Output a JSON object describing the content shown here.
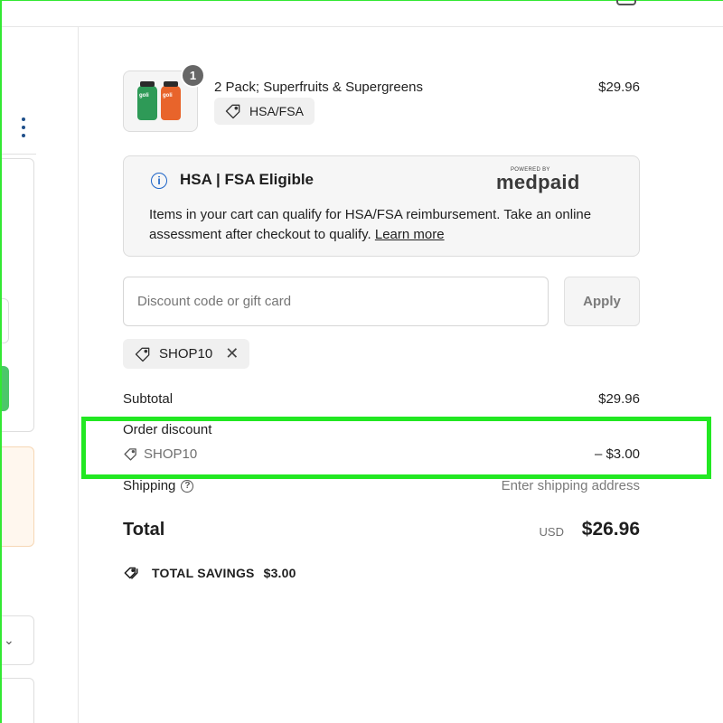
{
  "product": {
    "quantity": "1",
    "title": "2 Pack; Superfruits & Supergreens",
    "price": "$29.96",
    "tag": "HSA/FSA",
    "bottle_label_1": "goli",
    "bottle_label_2": "goli"
  },
  "hsa_box": {
    "title": "HSA | FSA Eligible",
    "powered_by": "POWERED BY",
    "brand": "medpaid",
    "body": "Items in your cart can qualify for HSA/FSA reimbursement. Take an online assessment after checkout to qualify.",
    "link": "Learn more"
  },
  "discount": {
    "placeholder": "Discount code or gift card",
    "value": "",
    "apply_label": "Apply",
    "applied_code": "SHOP10"
  },
  "summary": {
    "subtotal_label": "Subtotal",
    "subtotal_value": "$29.96",
    "order_discount_label": "Order discount",
    "order_discount_code": "SHOP10",
    "order_discount_value": "– $3.00",
    "shipping_label": "Shipping",
    "shipping_value": "Enter shipping address",
    "total_label": "Total",
    "total_currency": "USD",
    "total_value": "$26.96",
    "savings_label": "TOTAL SAVINGS",
    "savings_value": "$3.00"
  },
  "colors": {
    "highlight": "#22e822",
    "info_blue": "#1d64c7",
    "left_button_green": "#4cc76a"
  }
}
